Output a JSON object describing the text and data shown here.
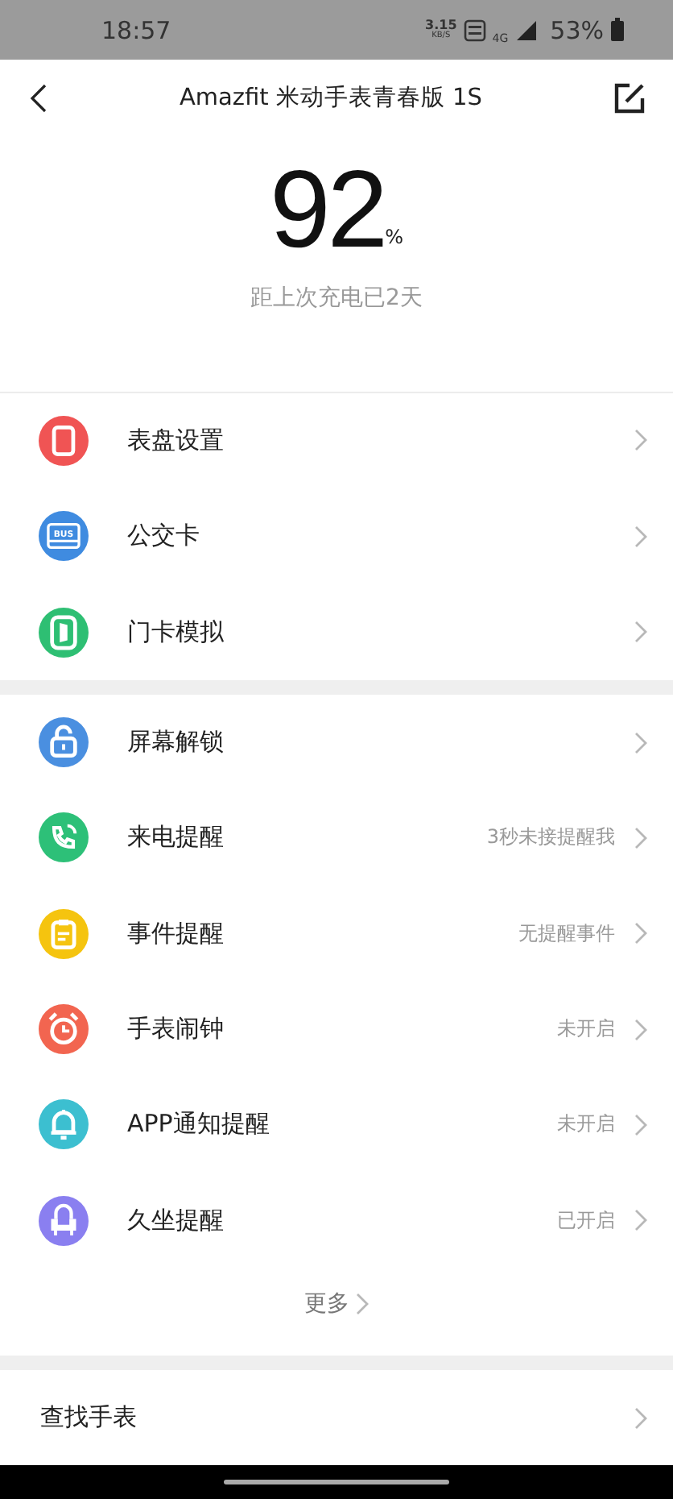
{
  "status_bar": {
    "time": "18:57",
    "speed": "3.15",
    "speed_unit": "KB/S",
    "network": "4G",
    "battery": "53%"
  },
  "header": {
    "title": "Amazfit 米动手表青春版 1S"
  },
  "battery": {
    "value": "92",
    "unit": "%",
    "note": "距上次充电已2天"
  },
  "sections": [
    {
      "items": [
        {
          "color": "#f05454",
          "label": "表盘设置"
        },
        {
          "color": "#3f8be0",
          "label": "公交卡",
          "icon_text": "BUS"
        },
        {
          "color": "#2ebf73",
          "label": "门卡模拟"
        }
      ]
    },
    {
      "items": [
        {
          "color": "#4a8fe0",
          "label": "屏幕解锁"
        },
        {
          "color": "#2dc078",
          "label": "来电提醒",
          "value": "3秒未接提醒我"
        },
        {
          "color": "#f5c40f",
          "label": "事件提醒",
          "value": "无提醒事件"
        },
        {
          "color": "#f26550",
          "label": "手表闹钟",
          "value": "未开启"
        },
        {
          "color": "#3cbfd0",
          "label": "APP通知提醒",
          "value": "未开启"
        },
        {
          "color": "#8a7ff0",
          "label": "久坐提醒",
          "value": "已开启"
        }
      ],
      "more": "更多"
    },
    {
      "items": [
        {
          "label": "查找手表"
        }
      ]
    }
  ]
}
